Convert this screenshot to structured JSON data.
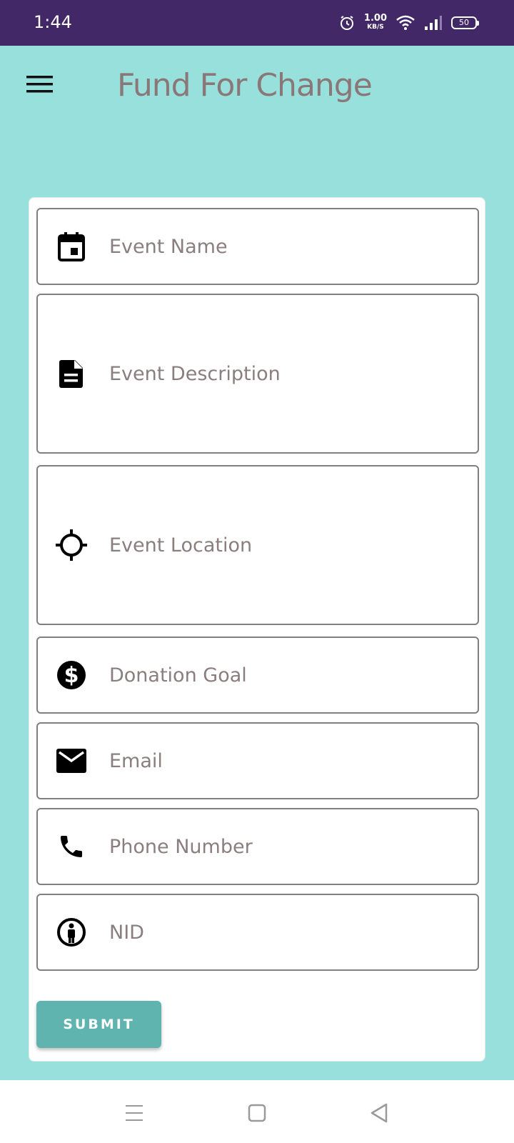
{
  "status_bar": {
    "time": "1:44",
    "net_speed": "1.00",
    "net_unit": "KB/S",
    "battery": "50"
  },
  "app_bar": {
    "title": "Fund For Change",
    "menu_icon": "hamburger-menu-icon"
  },
  "form": {
    "fields": [
      {
        "icon": "calendar-icon",
        "placeholder": "Event Name",
        "value": ""
      },
      {
        "icon": "document-icon",
        "placeholder": "Event Description",
        "value": ""
      },
      {
        "icon": "location-target-icon",
        "placeholder": "Event Location",
        "value": ""
      },
      {
        "icon": "dollar-icon",
        "placeholder": "Donation Goal",
        "value": ""
      },
      {
        "icon": "email-icon",
        "placeholder": "Email",
        "value": ""
      },
      {
        "icon": "phone-icon",
        "placeholder": "Phone Number",
        "value": ""
      },
      {
        "icon": "person-info-icon",
        "placeholder": "NID",
        "value": ""
      }
    ],
    "submit_label": "SUBMIT"
  },
  "colors": {
    "status_bar": "#432868",
    "background": "#98e0dc",
    "title": "#8a7878",
    "button": "#60b4b0"
  }
}
